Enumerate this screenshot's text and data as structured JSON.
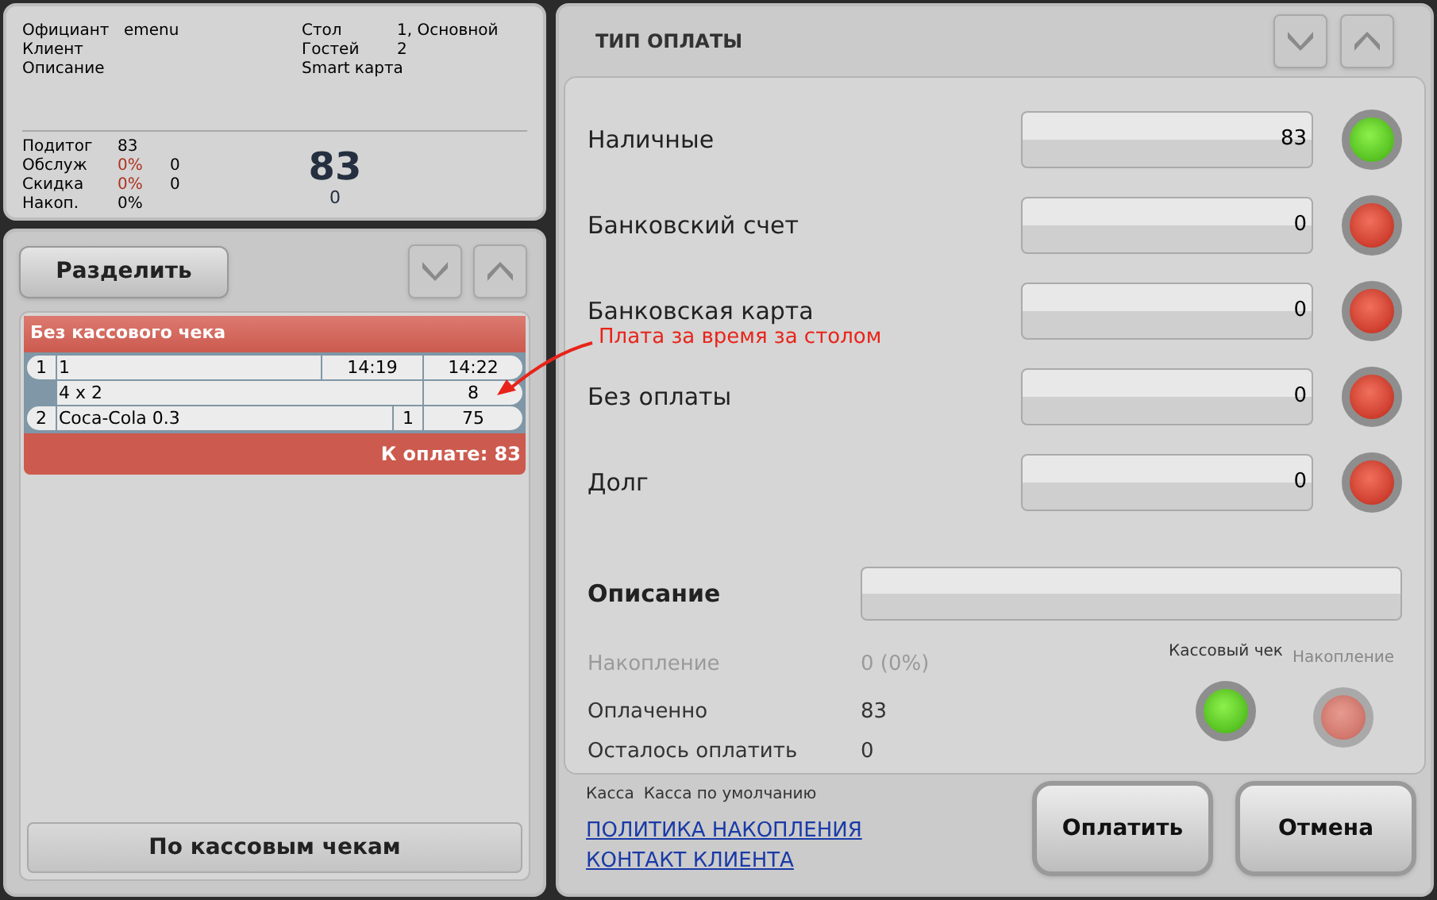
{
  "order_info": {
    "left": [
      {
        "label": "Официант",
        "value": "emenu"
      },
      {
        "label": "Клиент"
      },
      {
        "label": "Описание"
      }
    ],
    "right": [
      {
        "label": "Стол",
        "value": "1, Основной"
      },
      {
        "label": "Гостей",
        "value": "2"
      },
      {
        "label": "Smart карта"
      }
    ],
    "totals": [
      {
        "label": "Подитог",
        "value": "83"
      },
      {
        "label": "Обслуж",
        "percent": "0%",
        "value": "0"
      },
      {
        "label": "Скидка",
        "percent": "0%",
        "value": "0"
      },
      {
        "label": "Накоп.",
        "percent": "0%"
      }
    ],
    "total": "83",
    "total_sub": "0"
  },
  "split_button": "Разделить",
  "receipt": {
    "title": "Без кассового чека",
    "rows": [
      {
        "num": "1",
        "name": "1",
        "col_3": "14:19",
        "col_4": "14:22",
        "sub": {
          "name": "4 x 2",
          "col_4": "8"
        }
      },
      {
        "num": "2",
        "name": "Coca-Cola 0.3",
        "col_3": "1",
        "col_4": "75"
      }
    ],
    "footer": "К оплате: 83"
  },
  "annotation": "Плата за время за столом",
  "by_receipts_button": "По кассовым чекам",
  "payment": {
    "title": "ТИП ОПЛАТЫ",
    "methods": [
      {
        "label": "Наличные",
        "value": "83",
        "on": true
      },
      {
        "label": "Банковский счет",
        "value": "0",
        "on": false
      },
      {
        "label": "Банковская карта",
        "value": "0",
        "on": false
      },
      {
        "label": "Без оплаты",
        "value": "0",
        "on": false
      },
      {
        "label": "Долг",
        "value": "0",
        "on": false
      }
    ],
    "description_label": "Описание",
    "summary": [
      {
        "label": "Накопление",
        "value": "0 (0%)",
        "disabled": true
      },
      {
        "label": "Оплаченно",
        "value": "83",
        "disabled": false
      },
      {
        "label": "Осталось оплатить",
        "value": "0",
        "disabled": false
      }
    ],
    "toggles": [
      {
        "label": "Кассовый чек",
        "on": true,
        "disabled": false
      },
      {
        "label": "Накопление",
        "on": false,
        "disabled": true
      }
    ]
  },
  "cash_register": {
    "label": "Касса",
    "value": "Касса по умолчанию"
  },
  "links": [
    "ПОЛИТИКА НАКОПЛЕНИЯ",
    "КОНТАКТ КЛИЕНТА"
  ],
  "buttons": [
    "Оплатить",
    "Отмена"
  ]
}
